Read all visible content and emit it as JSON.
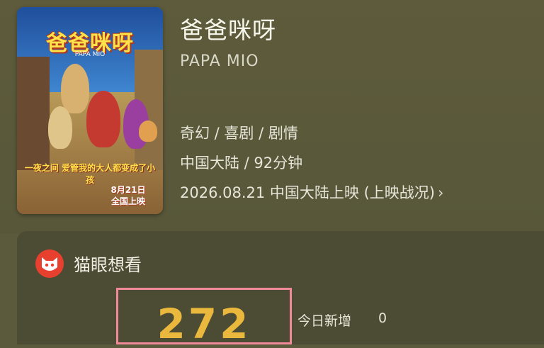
{
  "movie": {
    "title": "爸爸咪呀",
    "english_title": "PAPA MIO",
    "genres": "奇幻 / 喜剧 / 剧情",
    "region_duration": "中国大陆 / 92分钟",
    "release": "2026.08.21 中国大陆上映 (上映战况)",
    "release_chevron": "›"
  },
  "poster": {
    "title": "爸爸咪呀",
    "subtitle": "PAPA MIO",
    "tagline": "一夜之间 爱管我的大人都变成了小孩",
    "date_line1": "8月21日",
    "date_line2": "全国上映"
  },
  "maoyan": {
    "label": "猫眼想看",
    "want_count": "272",
    "today_label": "今日新增",
    "today_value": "0"
  },
  "colors": {
    "accent": "#e9b83c",
    "highlight_border": "#f08a9a",
    "brand_red": "#e8402f"
  }
}
